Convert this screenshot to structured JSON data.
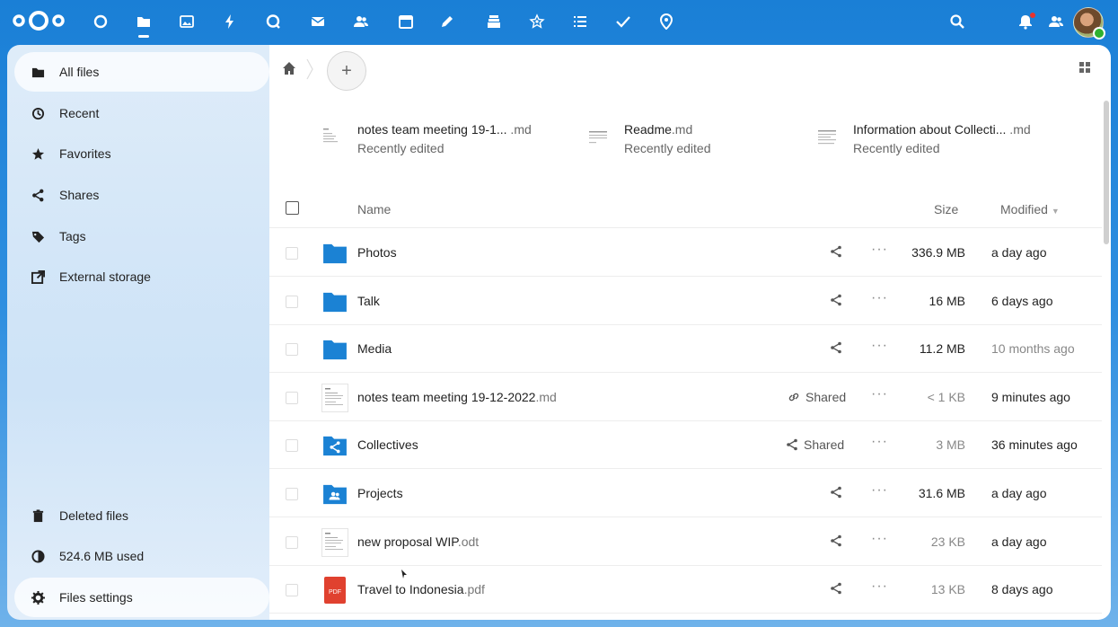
{
  "header": {
    "apps": [
      "dashboard",
      "files",
      "photos",
      "activity",
      "talk",
      "mail",
      "contacts",
      "calendar",
      "notes",
      "deck",
      "tasks-star",
      "tasks-list",
      "checkmark",
      "maps"
    ],
    "right": [
      "search",
      "notifications",
      "contacts-menu",
      "avatar"
    ]
  },
  "sidebar": {
    "items": [
      {
        "label": "All files",
        "icon": "folder-icon"
      },
      {
        "label": "Recent",
        "icon": "clock-icon"
      },
      {
        "label": "Favorites",
        "icon": "star-icon"
      },
      {
        "label": "Shares",
        "icon": "share-icon"
      },
      {
        "label": "Tags",
        "icon": "tag-icon"
      },
      {
        "label": "External storage",
        "icon": "external-icon"
      }
    ],
    "bottom": [
      {
        "label": "Deleted files",
        "icon": "trash-icon"
      },
      {
        "label": "524.6 MB used",
        "icon": "quota-icon"
      },
      {
        "label": "Files settings",
        "icon": "gear-icon"
      }
    ]
  },
  "breadcrumb": {
    "add": "+"
  },
  "recent": [
    {
      "name": "notes team meeting 19-1...",
      "ext": " .md",
      "sub": "Recently edited"
    },
    {
      "name": "Readme",
      "ext": ".md",
      "sub": "Recently edited"
    },
    {
      "name": "Information about Collecti...",
      "ext": " .md",
      "sub": "Recently edited"
    }
  ],
  "table": {
    "headers": {
      "name": "Name",
      "size": "Size",
      "modified": "Modified"
    },
    "rows": [
      {
        "name": "Photos",
        "ext": "",
        "type": "folder",
        "shared": "",
        "size": "336.9 MB",
        "size_dark": true,
        "modified": "a day ago",
        "mod_muted": false
      },
      {
        "name": "Talk",
        "ext": "",
        "type": "folder",
        "shared": "",
        "size": "16 MB",
        "size_dark": true,
        "modified": "6 days ago",
        "mod_muted": false
      },
      {
        "name": "Media",
        "ext": "",
        "type": "folder",
        "shared": "",
        "size": "11.2 MB",
        "size_dark": true,
        "modified": "10 months ago",
        "mod_muted": true
      },
      {
        "name": "notes team meeting 19-12-2022",
        "ext": ".md",
        "type": "doc",
        "shared": "Shared",
        "shared_icon": "link",
        "size": "< 1 KB",
        "size_dark": false,
        "modified": "9 minutes ago",
        "mod_muted": false
      },
      {
        "name": "Collectives",
        "ext": "",
        "type": "folder-shared",
        "shared": "Shared",
        "shared_icon": "share",
        "size": "3 MB",
        "size_dark": false,
        "modified": "36 minutes ago",
        "mod_muted": false
      },
      {
        "name": "Projects",
        "ext": "",
        "type": "folder-group",
        "shared": "",
        "size": "31.6 MB",
        "size_dark": true,
        "modified": "a day ago",
        "mod_muted": false
      },
      {
        "name": "new proposal WIP",
        "ext": ".odt",
        "type": "doc",
        "shared": "",
        "size": "23 KB",
        "size_dark": false,
        "modified": "a day ago",
        "mod_muted": false
      },
      {
        "name": "Travel to Indonesia",
        "ext": ".pdf",
        "type": "pdf",
        "shared": "",
        "size": "13 KB",
        "size_dark": false,
        "modified": "8 days ago",
        "mod_muted": false
      }
    ],
    "more": "···",
    "pdf_label": "PDF"
  },
  "colors": {
    "brand": "#1a7fd6",
    "folder": "#1b82d4",
    "pdf": "#e0412f"
  }
}
